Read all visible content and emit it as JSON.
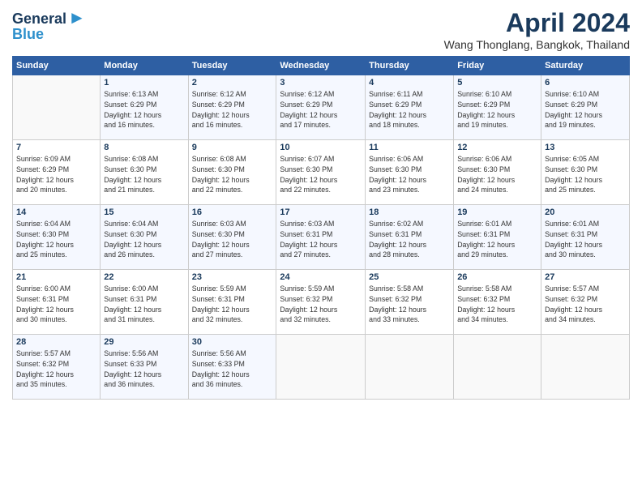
{
  "logo": {
    "line1": "General",
    "line2": "Blue"
  },
  "title": "April 2024",
  "location": "Wang Thonglang, Bangkok, Thailand",
  "weekdays": [
    "Sunday",
    "Monday",
    "Tuesday",
    "Wednesday",
    "Thursday",
    "Friday",
    "Saturday"
  ],
  "weeks": [
    [
      {
        "day": "",
        "info": ""
      },
      {
        "day": "1",
        "info": "Sunrise: 6:13 AM\nSunset: 6:29 PM\nDaylight: 12 hours\nand 16 minutes."
      },
      {
        "day": "2",
        "info": "Sunrise: 6:12 AM\nSunset: 6:29 PM\nDaylight: 12 hours\nand 16 minutes."
      },
      {
        "day": "3",
        "info": "Sunrise: 6:12 AM\nSunset: 6:29 PM\nDaylight: 12 hours\nand 17 minutes."
      },
      {
        "day": "4",
        "info": "Sunrise: 6:11 AM\nSunset: 6:29 PM\nDaylight: 12 hours\nand 18 minutes."
      },
      {
        "day": "5",
        "info": "Sunrise: 6:10 AM\nSunset: 6:29 PM\nDaylight: 12 hours\nand 19 minutes."
      },
      {
        "day": "6",
        "info": "Sunrise: 6:10 AM\nSunset: 6:29 PM\nDaylight: 12 hours\nand 19 minutes."
      }
    ],
    [
      {
        "day": "7",
        "info": "Sunrise: 6:09 AM\nSunset: 6:29 PM\nDaylight: 12 hours\nand 20 minutes."
      },
      {
        "day": "8",
        "info": "Sunrise: 6:08 AM\nSunset: 6:30 PM\nDaylight: 12 hours\nand 21 minutes."
      },
      {
        "day": "9",
        "info": "Sunrise: 6:08 AM\nSunset: 6:30 PM\nDaylight: 12 hours\nand 22 minutes."
      },
      {
        "day": "10",
        "info": "Sunrise: 6:07 AM\nSunset: 6:30 PM\nDaylight: 12 hours\nand 22 minutes."
      },
      {
        "day": "11",
        "info": "Sunrise: 6:06 AM\nSunset: 6:30 PM\nDaylight: 12 hours\nand 23 minutes."
      },
      {
        "day": "12",
        "info": "Sunrise: 6:06 AM\nSunset: 6:30 PM\nDaylight: 12 hours\nand 24 minutes."
      },
      {
        "day": "13",
        "info": "Sunrise: 6:05 AM\nSunset: 6:30 PM\nDaylight: 12 hours\nand 25 minutes."
      }
    ],
    [
      {
        "day": "14",
        "info": "Sunrise: 6:04 AM\nSunset: 6:30 PM\nDaylight: 12 hours\nand 25 minutes."
      },
      {
        "day": "15",
        "info": "Sunrise: 6:04 AM\nSunset: 6:30 PM\nDaylight: 12 hours\nand 26 minutes."
      },
      {
        "day": "16",
        "info": "Sunrise: 6:03 AM\nSunset: 6:30 PM\nDaylight: 12 hours\nand 27 minutes."
      },
      {
        "day": "17",
        "info": "Sunrise: 6:03 AM\nSunset: 6:31 PM\nDaylight: 12 hours\nand 27 minutes."
      },
      {
        "day": "18",
        "info": "Sunrise: 6:02 AM\nSunset: 6:31 PM\nDaylight: 12 hours\nand 28 minutes."
      },
      {
        "day": "19",
        "info": "Sunrise: 6:01 AM\nSunset: 6:31 PM\nDaylight: 12 hours\nand 29 minutes."
      },
      {
        "day": "20",
        "info": "Sunrise: 6:01 AM\nSunset: 6:31 PM\nDaylight: 12 hours\nand 30 minutes."
      }
    ],
    [
      {
        "day": "21",
        "info": "Sunrise: 6:00 AM\nSunset: 6:31 PM\nDaylight: 12 hours\nand 30 minutes."
      },
      {
        "day": "22",
        "info": "Sunrise: 6:00 AM\nSunset: 6:31 PM\nDaylight: 12 hours\nand 31 minutes."
      },
      {
        "day": "23",
        "info": "Sunrise: 5:59 AM\nSunset: 6:31 PM\nDaylight: 12 hours\nand 32 minutes."
      },
      {
        "day": "24",
        "info": "Sunrise: 5:59 AM\nSunset: 6:32 PM\nDaylight: 12 hours\nand 32 minutes."
      },
      {
        "day": "25",
        "info": "Sunrise: 5:58 AM\nSunset: 6:32 PM\nDaylight: 12 hours\nand 33 minutes."
      },
      {
        "day": "26",
        "info": "Sunrise: 5:58 AM\nSunset: 6:32 PM\nDaylight: 12 hours\nand 34 minutes."
      },
      {
        "day": "27",
        "info": "Sunrise: 5:57 AM\nSunset: 6:32 PM\nDaylight: 12 hours\nand 34 minutes."
      }
    ],
    [
      {
        "day": "28",
        "info": "Sunrise: 5:57 AM\nSunset: 6:32 PM\nDaylight: 12 hours\nand 35 minutes."
      },
      {
        "day": "29",
        "info": "Sunrise: 5:56 AM\nSunset: 6:33 PM\nDaylight: 12 hours\nand 36 minutes."
      },
      {
        "day": "30",
        "info": "Sunrise: 5:56 AM\nSunset: 6:33 PM\nDaylight: 12 hours\nand 36 minutes."
      },
      {
        "day": "",
        "info": ""
      },
      {
        "day": "",
        "info": ""
      },
      {
        "day": "",
        "info": ""
      },
      {
        "day": "",
        "info": ""
      }
    ]
  ]
}
